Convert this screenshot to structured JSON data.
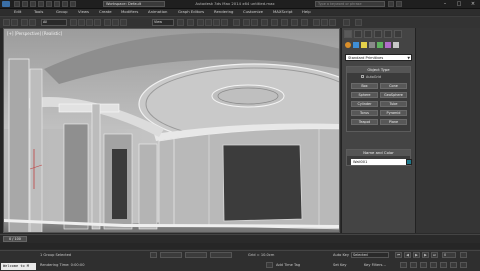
{
  "titlebar": {
    "workspace": "Workspace: Default",
    "title": "Autodesk 3ds Max 2014 x64    untitled.max",
    "search_placeholder": "Type a keyword or phrase"
  },
  "menu": [
    "Edit",
    "Tools",
    "Group",
    "Views",
    "Create",
    "Modifiers",
    "Animation",
    "Graph Editors",
    "Rendering",
    "Customize",
    "MAXScript",
    "Help"
  ],
  "toolbar": {
    "selection_filter": "All",
    "ref_coord": "View"
  },
  "viewport": {
    "label": "[+] [Perspective] [Realistic]"
  },
  "command_panel": {
    "dropdown": "Standard Primitives",
    "object_type_header": "Object Type",
    "autogrid_label": "AutoGrid",
    "objects": [
      "Box",
      "Cone",
      "Sphere",
      "GeoSphere",
      "Cylinder",
      "Tube",
      "Torus",
      "Pyramid",
      "Teapot",
      "Plane"
    ],
    "name_color_header": "Name and Color",
    "name_value": "Wall001"
  },
  "timeline": {
    "frame": "0 / 100"
  },
  "status": {
    "listener": "Welcome to M",
    "selection": "1 Group Selected",
    "prompt": "Rendering Time: 0:00:00",
    "grid": "Grid = 10.0cm",
    "add_time_tag": "Add Time Tag",
    "auto_key": "Auto Key",
    "selected": "Selected",
    "set_key": "Set Key",
    "key_filters": "Key Filters...",
    "frame_field": "0"
  },
  "colors": {
    "accent": "#3a6ea5",
    "wall_color": "#1e7a8c"
  }
}
